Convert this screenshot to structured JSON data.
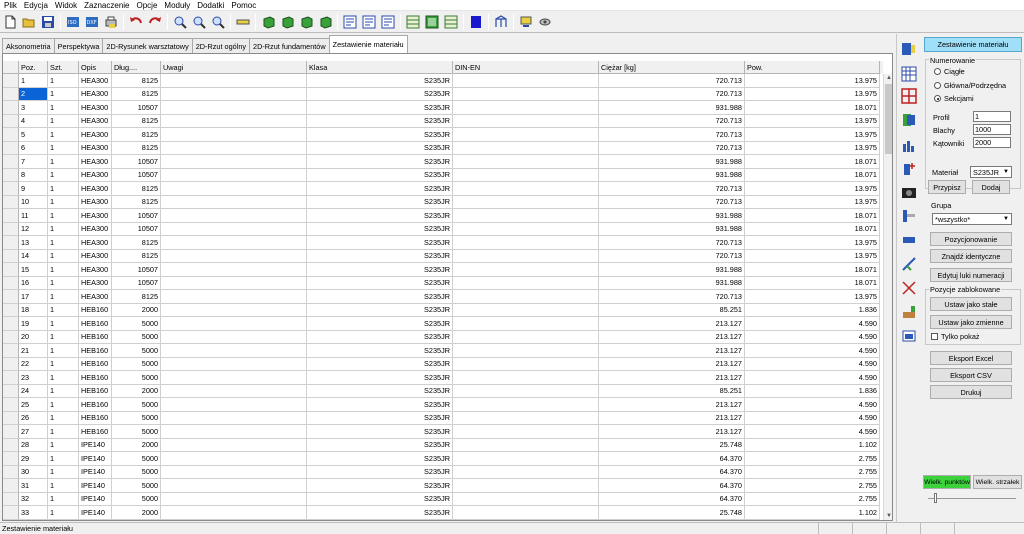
{
  "menu": [
    "Plik",
    "Edycja",
    "Widok",
    "Zaznaczenie",
    "Opcje",
    "Moduły",
    "Dodatki",
    "Pomoc"
  ],
  "toolbar_icons": [
    "new-file-icon",
    "open-folder-icon",
    "save-icon",
    "isometric-view-icon",
    "export-dxf-icon",
    "print-icon",
    "undo-icon",
    "redo-icon",
    "zoom-in-icon",
    "zoom-out-icon",
    "zoom-window-icon",
    "measure-icon",
    "cube-front-icon",
    "cube-side-icon",
    "cube-top-icon",
    "cube-iso-icon",
    "numbering-a-icon",
    "numbering-b-icon",
    "numbering-c-icon",
    "layout-grid-icon",
    "layout-dim-icon",
    "layout-detail-icon",
    "color-fill-icon",
    "structure-icon",
    "settings-icon",
    "camera-icon"
  ],
  "tabs": [
    {
      "label": "Aksonometria",
      "active": false
    },
    {
      "label": "Perspektywa",
      "active": false
    },
    {
      "label": "2D-Rysunek warsztatowy",
      "active": false
    },
    {
      "label": "2D-Rzut ogólny",
      "active": false
    },
    {
      "label": "2D-Rzut fundamentów",
      "active": false
    },
    {
      "label": "Zestawienie materiału",
      "active": true
    }
  ],
  "table": {
    "columns": [
      "Poz.",
      "Szt.",
      "Opis",
      "Dług....",
      "Uwagi",
      "Klasa",
      "DIN-EN",
      "Ciężar [kg]",
      "Pow."
    ],
    "selected_row": 1,
    "rows": [
      [
        "1",
        "1",
        "HEA300",
        "8125",
        "",
        "S235JR",
        "",
        "720.713",
        "13.975"
      ],
      [
        "2",
        "1",
        "HEA300",
        "8125",
        "",
        "S235JR",
        "",
        "720.713",
        "13.975"
      ],
      [
        "3",
        "1",
        "HEA300",
        "10507",
        "",
        "S235JR",
        "",
        "931.988",
        "18.071"
      ],
      [
        "4",
        "1",
        "HEA300",
        "8125",
        "",
        "S235JR",
        "",
        "720.713",
        "13.975"
      ],
      [
        "5",
        "1",
        "HEA300",
        "8125",
        "",
        "S235JR",
        "",
        "720.713",
        "13.975"
      ],
      [
        "6",
        "1",
        "HEA300",
        "8125",
        "",
        "S235JR",
        "",
        "720.713",
        "13.975"
      ],
      [
        "7",
        "1",
        "HEA300",
        "10507",
        "",
        "S235JR",
        "",
        "931.988",
        "18.071"
      ],
      [
        "8",
        "1",
        "HEA300",
        "10507",
        "",
        "S235JR",
        "",
        "931.988",
        "18.071"
      ],
      [
        "9",
        "1",
        "HEA300",
        "8125",
        "",
        "S235JR",
        "",
        "720.713",
        "13.975"
      ],
      [
        "10",
        "1",
        "HEA300",
        "8125",
        "",
        "S235JR",
        "",
        "720.713",
        "13.975"
      ],
      [
        "11",
        "1",
        "HEA300",
        "10507",
        "",
        "S235JR",
        "",
        "931.988",
        "18.071"
      ],
      [
        "12",
        "1",
        "HEA300",
        "10507",
        "",
        "S235JR",
        "",
        "931.988",
        "18.071"
      ],
      [
        "13",
        "1",
        "HEA300",
        "8125",
        "",
        "S235JR",
        "",
        "720.713",
        "13.975"
      ],
      [
        "14",
        "1",
        "HEA300",
        "8125",
        "",
        "S235JR",
        "",
        "720.713",
        "13.975"
      ],
      [
        "15",
        "1",
        "HEA300",
        "10507",
        "",
        "S235JR",
        "",
        "931.988",
        "18.071"
      ],
      [
        "16",
        "1",
        "HEA300",
        "10507",
        "",
        "S235JR",
        "",
        "931.988",
        "18.071"
      ],
      [
        "17",
        "1",
        "HEA300",
        "8125",
        "",
        "S235JR",
        "",
        "720.713",
        "13.975"
      ],
      [
        "18",
        "1",
        "HEB160",
        "2000",
        "",
        "S235JR",
        "",
        "85.251",
        "1.836"
      ],
      [
        "19",
        "1",
        "HEB160",
        "5000",
        "",
        "S235JR",
        "",
        "213.127",
        "4.590"
      ],
      [
        "20",
        "1",
        "HEB160",
        "5000",
        "",
        "S235JR",
        "",
        "213.127",
        "4.590"
      ],
      [
        "21",
        "1",
        "HEB160",
        "5000",
        "",
        "S235JR",
        "",
        "213.127",
        "4.590"
      ],
      [
        "22",
        "1",
        "HEB160",
        "5000",
        "",
        "S235JR",
        "",
        "213.127",
        "4.590"
      ],
      [
        "23",
        "1",
        "HEB160",
        "5000",
        "",
        "S235JR",
        "",
        "213.127",
        "4.590"
      ],
      [
        "24",
        "1",
        "HEB160",
        "2000",
        "",
        "S235JR",
        "",
        "85.251",
        "1.836"
      ],
      [
        "25",
        "1",
        "HEB160",
        "5000",
        "",
        "S235JR",
        "",
        "213.127",
        "4.590"
      ],
      [
        "26",
        "1",
        "HEB160",
        "5000",
        "",
        "S235JR",
        "",
        "213.127",
        "4.590"
      ],
      [
        "27",
        "1",
        "HEB160",
        "5000",
        "",
        "S235JR",
        "",
        "213.127",
        "4.590"
      ],
      [
        "28",
        "1",
        "IPE140",
        "2000",
        "",
        "S235JR",
        "",
        "25.748",
        "1.102"
      ],
      [
        "29",
        "1",
        "IPE140",
        "5000",
        "",
        "S235JR",
        "",
        "64.370",
        "2.755"
      ],
      [
        "30",
        "1",
        "IPE140",
        "5000",
        "",
        "S235JR",
        "",
        "64.370",
        "2.755"
      ],
      [
        "31",
        "1",
        "IPE140",
        "5000",
        "",
        "S235JR",
        "",
        "64.370",
        "2.755"
      ],
      [
        "32",
        "1",
        "IPE140",
        "5000",
        "",
        "S235JR",
        "",
        "64.370",
        "2.755"
      ],
      [
        "33",
        "1",
        "IPE140",
        "2000",
        "",
        "S235JR",
        "",
        "25.748",
        "1.102"
      ]
    ]
  },
  "side_icons": [
    "material-list-icon",
    "grid-view-icon",
    "frame-icon",
    "copy-element-icon",
    "chart-icon",
    "add-element-icon",
    "camera-icon",
    "beam-icon",
    "column-icon",
    "brace-icon",
    "cross-icon",
    "component-icon",
    "window-icon"
  ],
  "panel": {
    "title_button": "Zestawienie materiału",
    "numbering_group": "Numerowanie",
    "radio_continuous": "Ciągłe",
    "radio_main_sub": "Główna/Podrzędna",
    "radio_sections": "Sekcjami",
    "profile_label": "Profil",
    "profile_value": "1",
    "plates_label": "Blachy",
    "plates_value": "1000",
    "angles_label": "Kątowniki",
    "angles_value": "2000",
    "material_label": "Materiał",
    "material_value": "S235JR",
    "assign_button": "Przypisz",
    "add_button": "Dodaj",
    "group_label": "Grupa",
    "group_value": "*wszystko*",
    "positioning_button": "Pozycjonowanie",
    "find_identical_button": "Znajdź identyczne",
    "edit_gaps_button": "Edytuj luki numeracji",
    "locked_group": "Pozycje zablokowane",
    "set_fixed_button": "Ustaw jako stałe",
    "set_variable_button": "Ustaw jako zmienne",
    "show_only_label": "Tylko pokaż",
    "export_excel_button": "Eksport Excel",
    "export_csv_button": "Eksport CSV",
    "print_button": "Drukuj",
    "point_size_button": "Wielk. punktów",
    "arrow_size_button": "Wielk. strzałek",
    "point_size_active_color": "#3cd23c"
  },
  "status": {
    "text": "Zestawienie materiału"
  }
}
